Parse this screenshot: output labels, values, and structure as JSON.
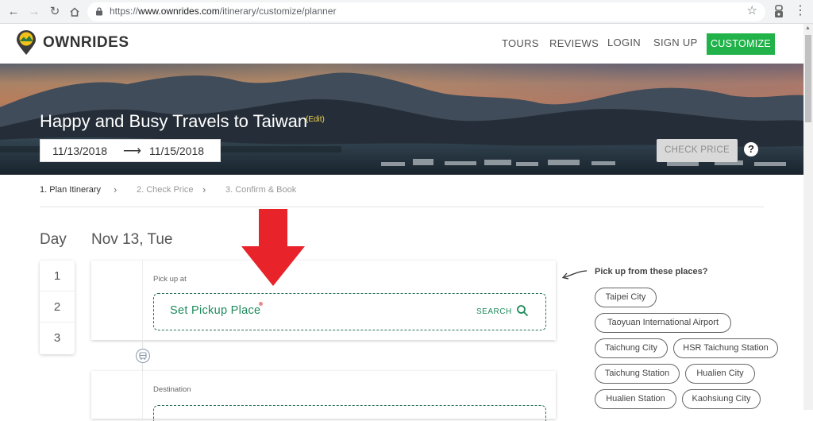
{
  "browser": {
    "url_scheme": "https://",
    "url_host": "www.ownrides.com",
    "url_path": "/itinerary/customize/planner"
  },
  "site": {
    "logo_text": "OWNRIDES",
    "nav": {
      "tours": "TOURS",
      "reviews": "REVIEWS",
      "login": "LOGIN",
      "signup": "SIGN UP",
      "customize": "CUSTOMIZE"
    }
  },
  "hero": {
    "title": "Happy and Busy Travels to Taiwan",
    "edit_label": "(Edit)",
    "start_date": "11/13/2018",
    "end_date": "11/15/2018",
    "check_price_label": "CHECK PRICE",
    "help_label": "?"
  },
  "steps": [
    "1. Plan Itinerary",
    "2. Check Price",
    "3. Confirm & Book"
  ],
  "planner": {
    "day_label": "Day",
    "date_heading": "Nov 13, Tue",
    "days": [
      "1",
      "2",
      "3"
    ],
    "pickup": {
      "label": "Pick up at",
      "placeholder": "Set Pickup Place",
      "search_label": "SEARCH"
    },
    "destination": {
      "label": "Destination"
    }
  },
  "suggestions": {
    "title": "Pick up from these places?",
    "places": [
      "Taipei City",
      "Taoyuan International Airport",
      "Taichung City",
      "HSR Taichung Station",
      "Taichung Station",
      "Hualien City",
      "Hualien Station",
      "Kaohsiung City"
    ]
  },
  "colors": {
    "brand_green": "#21b34a",
    "field_green": "#1e8a5b",
    "annotation_red": "#e8232a",
    "edit_yellow": "#f3d34a"
  }
}
